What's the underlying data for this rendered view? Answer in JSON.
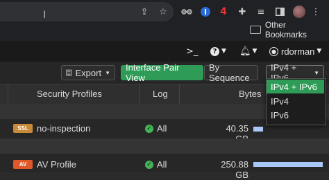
{
  "browser": {
    "bookmarks_label": "Other Bookmarks",
    "notification_count": "4"
  },
  "header": {
    "username": "rdorman"
  },
  "toolbar": {
    "export_label": "Export",
    "interface_pair_view_label": "Interface Pair View",
    "by_sequence_label": "By Sequence",
    "address_family_value": "IPv4 + IPv6"
  },
  "address_family_menu": {
    "options": [
      "IPv4 + IPv6",
      "IPv4",
      "IPv6"
    ],
    "selected": "IPv4 + IPv6"
  },
  "table": {
    "columns": [
      "Security Profiles",
      "Log",
      "Bytes"
    ],
    "rows": [
      {
        "profile_tag": "SSL",
        "profile": "no-inspection",
        "log": "All",
        "bytes": "40.35 GB",
        "bytes_fraction": 0.14
      },
      {
        "profile_tag": "AV",
        "profile": "AV Profile",
        "log": "All",
        "bytes": "250.88 GB",
        "bytes_fraction": 1.0
      }
    ]
  },
  "colors": {
    "accent_green": "#2e9b56",
    "ssl_tag": "#c98a3a",
    "av_tag": "#e0582a",
    "bytes_bar": "#a9c7f7",
    "log_check": "#43b35a"
  }
}
